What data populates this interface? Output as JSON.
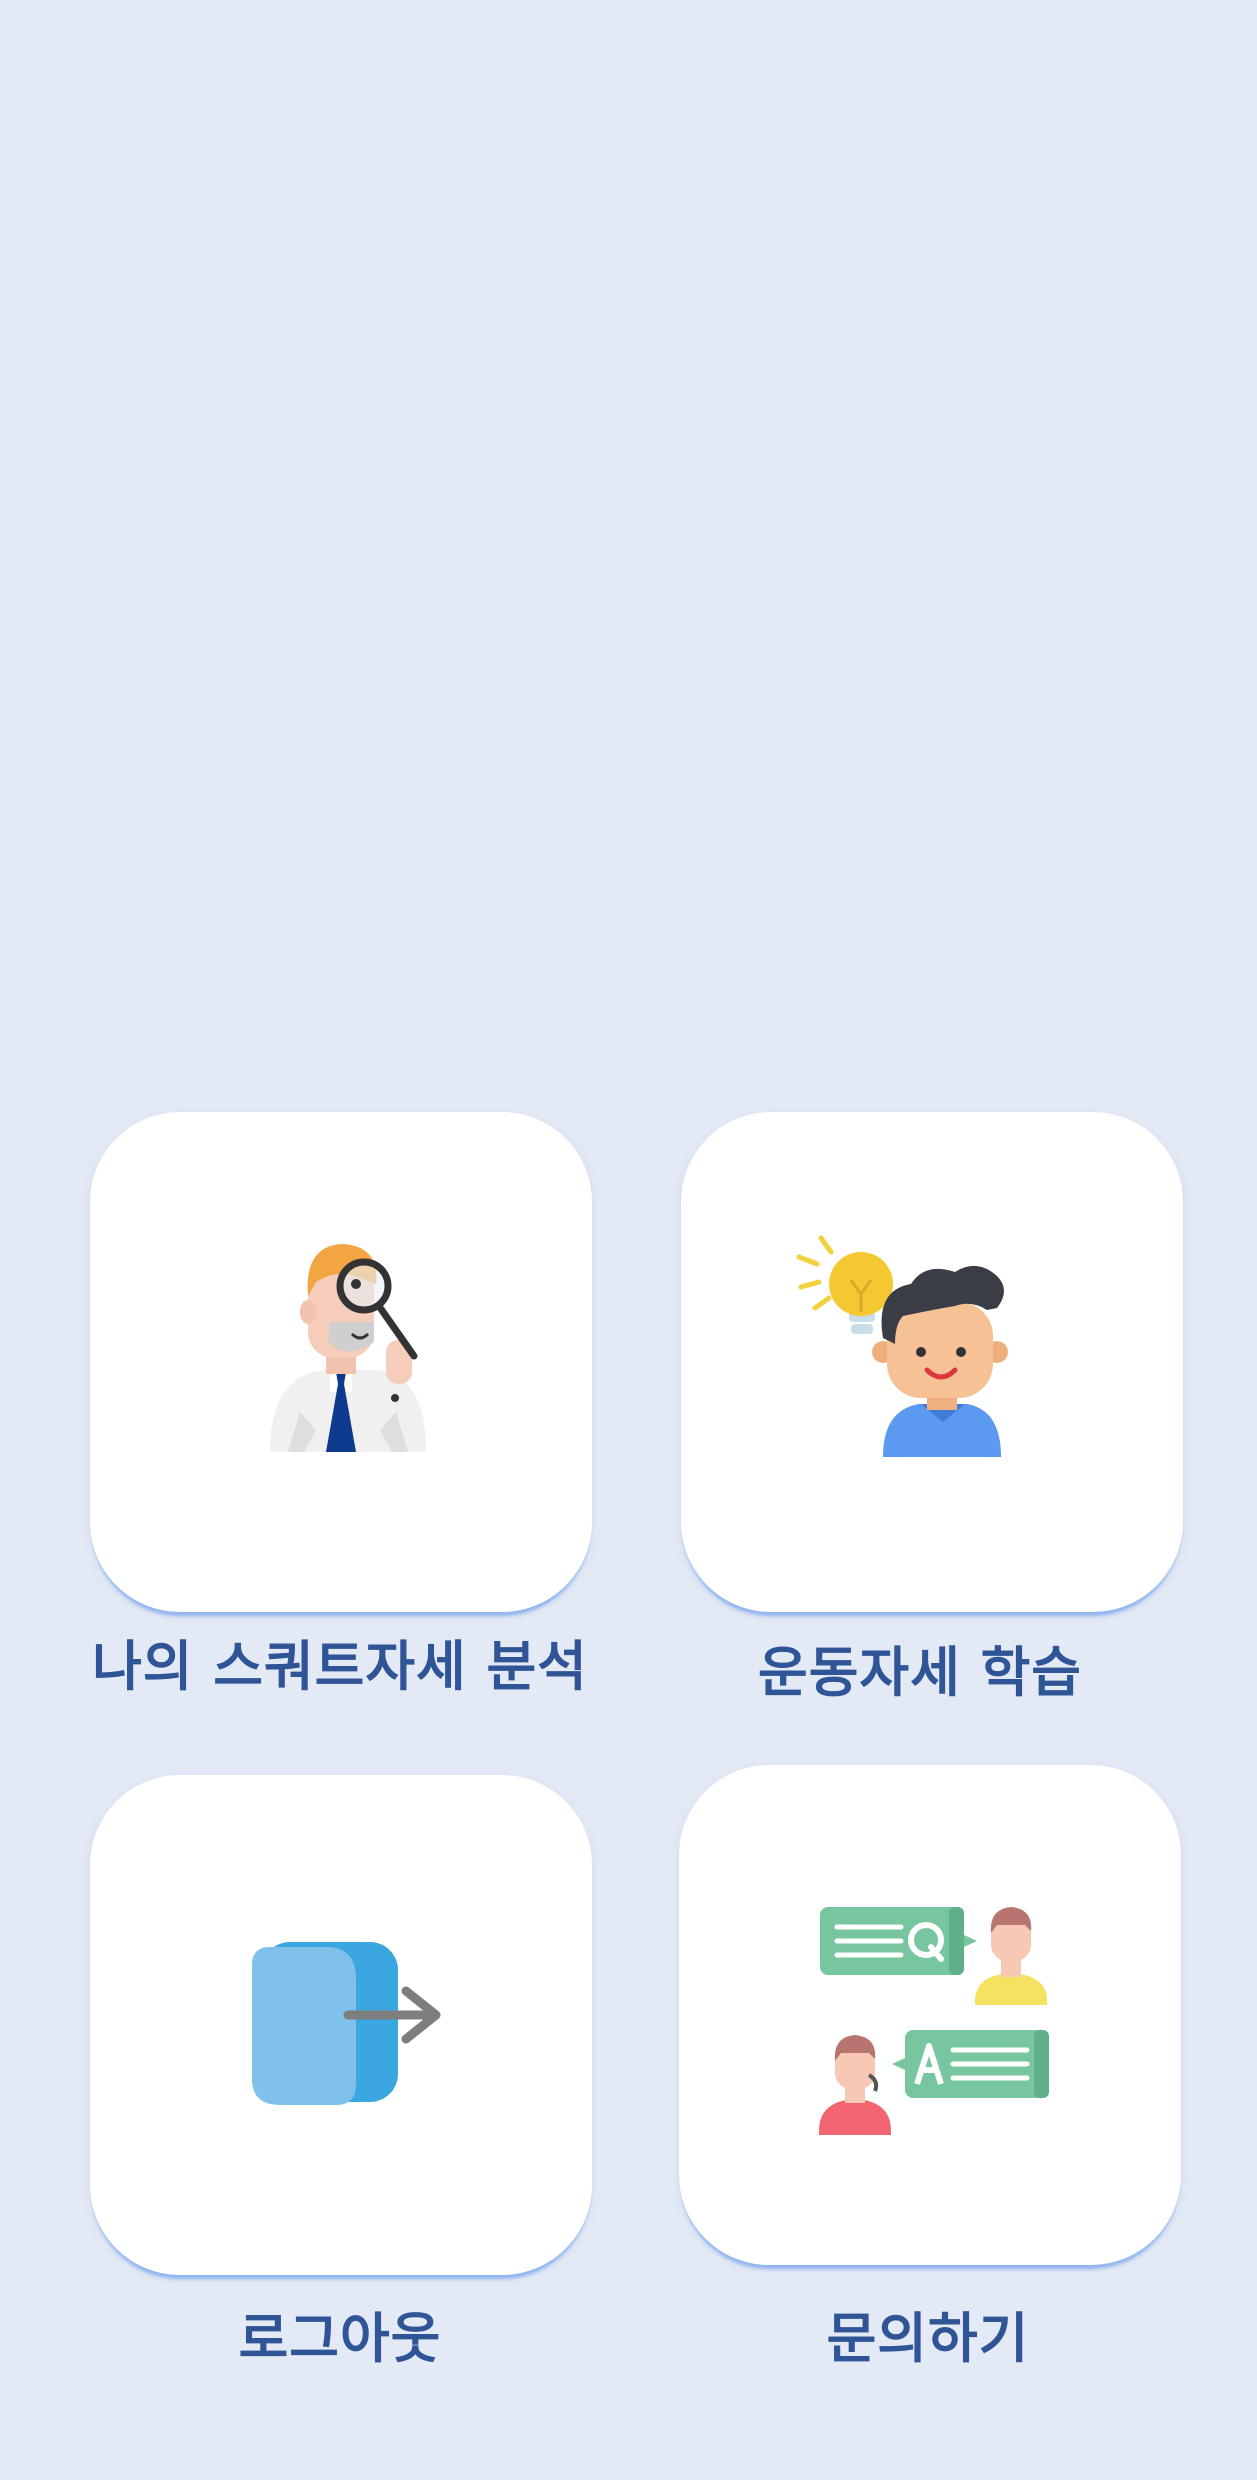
{
  "menu": {
    "items": [
      {
        "label": "나의 스쿼트자세 분석",
        "icon": "detective-magnifier-icon"
      },
      {
        "label": "운동자세 학습",
        "icon": "boy-lightbulb-icon"
      },
      {
        "label": "로그아웃",
        "icon": "logout-icon"
      },
      {
        "label": "문의하기",
        "icon": "qa-chat-icon"
      }
    ]
  },
  "colors": {
    "background": "#e4eaf5",
    "card": "#ffffff",
    "label_text": "#2f5596",
    "card_shadow": "#78a5f0"
  }
}
